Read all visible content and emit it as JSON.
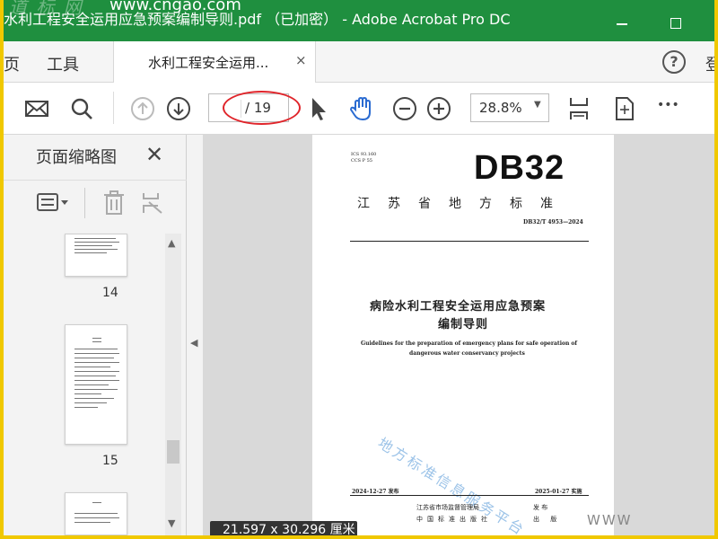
{
  "window": {
    "title": "水利工程安全运用应急预案编制导则.pdf （已加密） - Adobe Acrobat Pro DC",
    "overlay_watermark": "www.cngao.com"
  },
  "menubar": {
    "home_label": "页",
    "tools_label": "工具",
    "tab_label": "水利工程安全运用...",
    "tab_close": "×",
    "help_label": "?",
    "login_label": "登"
  },
  "toolbar": {
    "page_current": "",
    "page_total": "/ 19",
    "zoom_value": "28.8%",
    "zoom_caret": "▼",
    "more_label": "•••"
  },
  "left_panel": {
    "title": "页面缩略图",
    "close": "✕",
    "thumbnails": [
      {
        "label": "14"
      },
      {
        "label": "15"
      }
    ]
  },
  "document": {
    "ics": "ICS 93.160",
    "ccs": "CCS P 55",
    "db_code": "DB32",
    "province": "江苏省地方标准",
    "std_code": "DB32/T 4953—2024",
    "title_cn_line1": "病险水利工程安全运用应急预案",
    "title_cn_line2": "编制导则",
    "title_en_line1": "Guidelines for the preparation of emergency plans for safe operation of",
    "title_en_line2": "dangerous water conservancy projects",
    "watermark": "地方标准信息服务平台",
    "publish_date": "2024-12-27 发布",
    "implement_date": "2025-01-27 实施",
    "org1": "江苏省市场监督管理局",
    "org1_right": "发 布",
    "org2": "中国标准出版社",
    "org2_right": "出 版"
  },
  "status": {
    "page_dims": "21.597 x 30.296 厘米",
    "corner_watermark": "WWW"
  },
  "colors": {
    "titlebar": "#1f8f3f",
    "outer_border": "#f0c800",
    "annotation_oval": "#e0252b"
  }
}
